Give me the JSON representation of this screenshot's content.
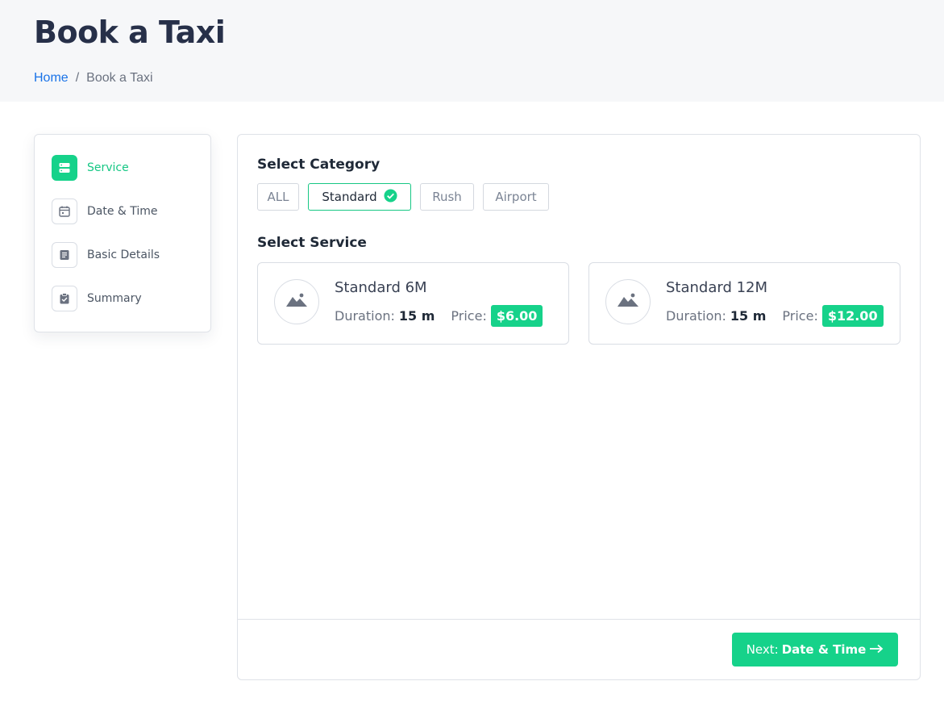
{
  "header": {
    "title": "Book a Taxi",
    "breadcrumb": {
      "home": "Home",
      "separator": "/",
      "current": "Book a Taxi"
    }
  },
  "steps": [
    {
      "label": "Service",
      "icon": "server-icon",
      "active": true
    },
    {
      "label": "Date & Time",
      "icon": "calendar-icon",
      "active": false
    },
    {
      "label": "Basic Details",
      "icon": "document-icon",
      "active": false
    },
    {
      "label": "Summary",
      "icon": "clipboard-check-icon",
      "active": false
    }
  ],
  "category": {
    "title": "Select Category",
    "options": [
      "ALL",
      "Standard",
      "Rush",
      "Airport"
    ],
    "selected": "Standard"
  },
  "service": {
    "title": "Select Service",
    "items": [
      {
        "name": "Standard 6M",
        "duration_label": "Duration:",
        "duration": "15 m",
        "price_label": "Price:",
        "price": "$6.00"
      },
      {
        "name": "Standard 12M",
        "duration_label": "Duration:",
        "duration": "15 m",
        "price_label": "Price:",
        "price": "$12.00"
      }
    ]
  },
  "footer": {
    "next_prefix": "Next:",
    "next_step": "Date & Time"
  },
  "colors": {
    "accent": "#16d28a",
    "link": "#1a73e8",
    "title": "#273049"
  }
}
